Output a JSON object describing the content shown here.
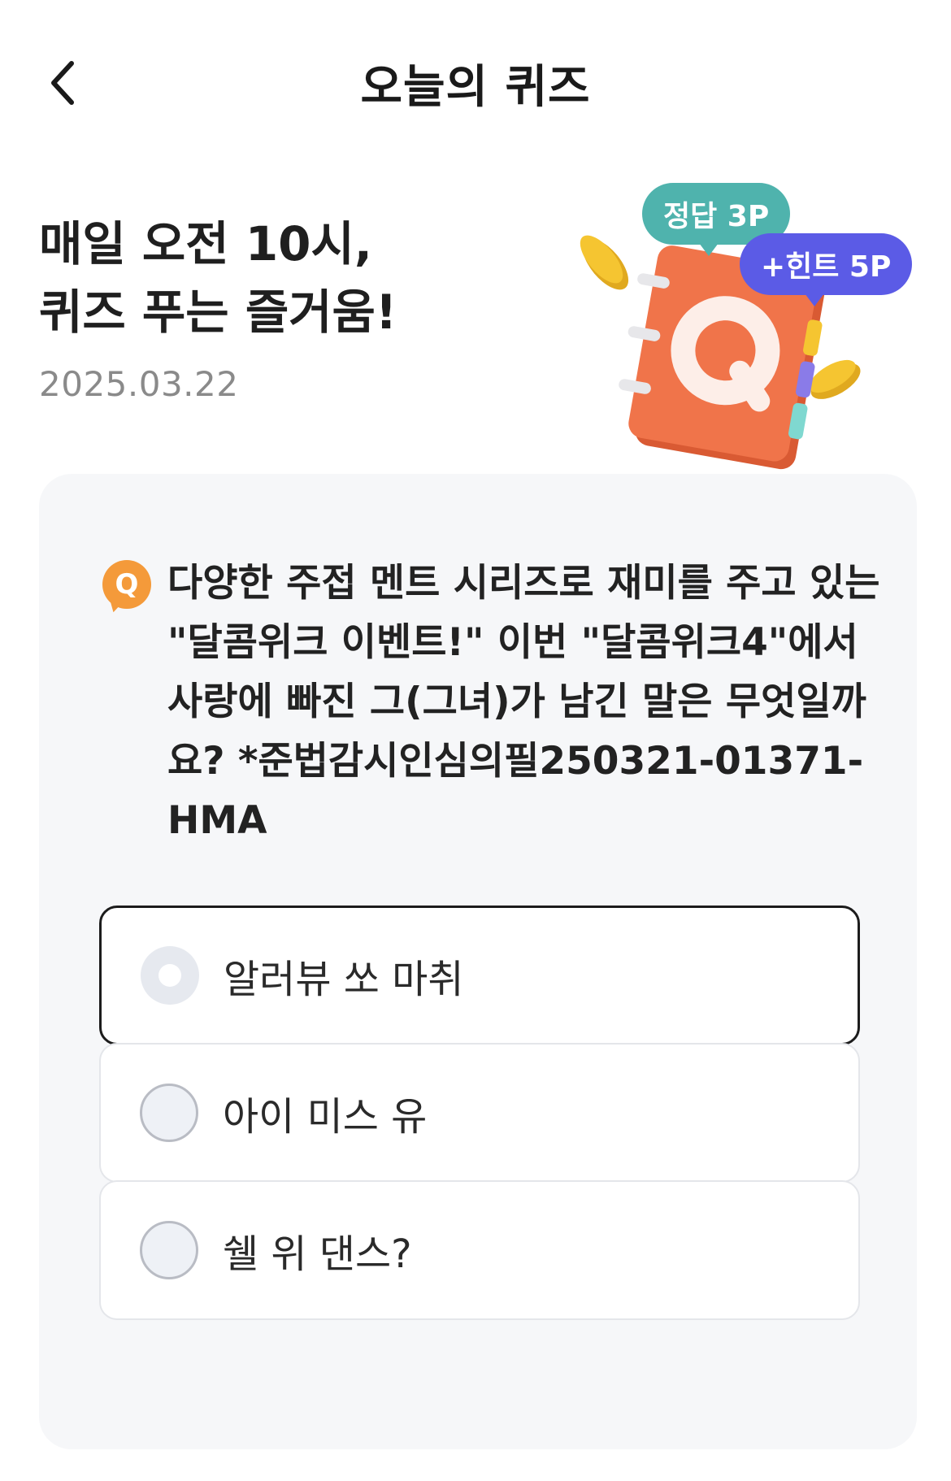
{
  "header": {
    "title": "오늘의 퀴즈"
  },
  "hero": {
    "title_line1": "매일 오전 10시,",
    "title_line2": "퀴즈 푸는 즐거움!",
    "date": "2025.03.22",
    "badge_answer": "정답 3P",
    "badge_hint": "+힌트 5P",
    "book_letter": "Q"
  },
  "quiz": {
    "icon_letter": "Q",
    "question": "다양한 주접 멘트 시리즈로 재미를 주고 있는 \"달콤위크 이벤트!\" 이번 \"달콤위크4\"에서 사랑에 빠진 그(그녀)가 남긴 말은 무엇일까요? *준법감시인심의필250321-01371-HMA",
    "options": [
      {
        "label": "알러뷰 쏘 마취",
        "selected": true
      },
      {
        "label": "아이 미스 유",
        "selected": false
      },
      {
        "label": "쉘 위 댄스?",
        "selected": false
      }
    ]
  },
  "colors": {
    "badge_answer": "#4fb3ad",
    "badge_hint": "#5b5be6",
    "book": "#f0744a",
    "coin": "#f5c531",
    "q_icon": "#f49a3a"
  },
  "icons": {
    "back": "chevron-left-icon"
  }
}
